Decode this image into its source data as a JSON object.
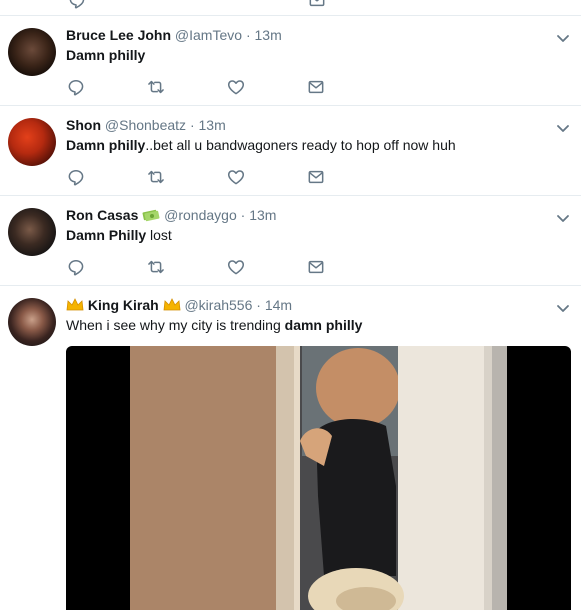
{
  "tweets": [
    {
      "name": "Bruce Lee John",
      "handle": "@IamTevo",
      "sep": "·",
      "time": "13m",
      "text_bold": "Damn philly",
      "text_rest": ""
    },
    {
      "name": "Shon",
      "handle": "@Shonbeatz",
      "sep": "·",
      "time": "13m",
      "text_bold": "Damn philly",
      "text_rest": "..bet all u bandwagoners ready to hop off now huh"
    },
    {
      "name": "Ron Casas",
      "handle": "@rondaygo",
      "sep": "·",
      "time": "13m",
      "text_bold": "Damn Philly",
      "text_rest": " lost"
    },
    {
      "name": "King Kirah",
      "handle": "@kirah556",
      "sep": "·",
      "time": "14m",
      "text_pre": "When i see why my city is trending ",
      "text_bold": "damn philly"
    }
  ],
  "icons": {
    "reply": "reply-icon",
    "retweet": "retweet-icon",
    "like": "heart-icon",
    "dm": "envelope-icon",
    "more": "chevron-down-icon"
  },
  "colors": {
    "icon": "#657786",
    "name": "#14171a",
    "meta": "#657786",
    "divider": "#e6ecf0"
  }
}
